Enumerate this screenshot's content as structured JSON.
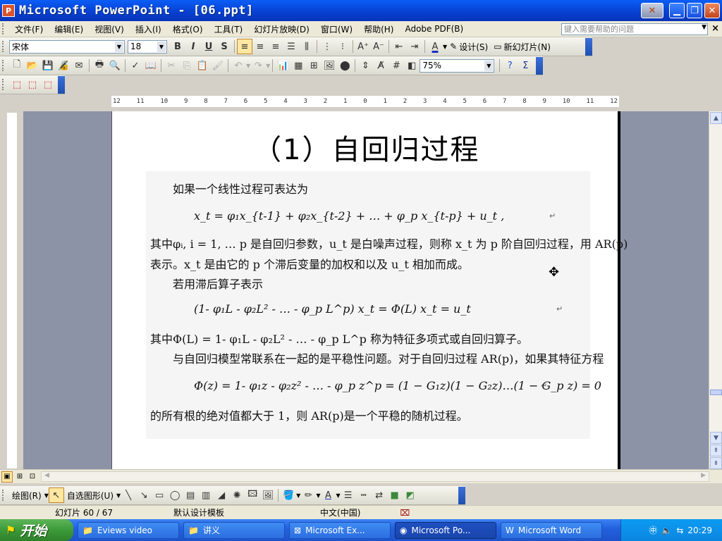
{
  "window": {
    "app_icon": "P",
    "title": "Microsoft PowerPoint - [06.ppt]"
  },
  "menu": {
    "items": [
      "文件(F)",
      "编辑(E)",
      "视图(V)",
      "插入(I)",
      "格式(O)",
      "工具(T)",
      "幻灯片放映(D)",
      "窗口(W)",
      "帮助(H)",
      "Adobe PDF(B)"
    ],
    "help_placeholder": "键入需要帮助的问题"
  },
  "formatting": {
    "font": "宋体",
    "size": "18",
    "design_label": "设计(S)",
    "new_slide_label": "新幻灯片(N)"
  },
  "standard": {
    "zoom": "75%"
  },
  "ruler": {
    "top_ticks": [
      "12",
      "11",
      "10",
      "9",
      "8",
      "7",
      "6",
      "5",
      "4",
      "3",
      "2",
      "1",
      "0",
      "1",
      "2",
      "3",
      "4",
      "5",
      "6",
      "7",
      "8",
      "9",
      "10",
      "11",
      "12"
    ]
  },
  "slide": {
    "title": "（1）自回归过程",
    "lines": [
      "如果一个线性过程可表达为",
      "x_t = φ₁x_{t-1} + φ₂x_{t-2} + … + φ_p x_{t-p} + u_t ,",
      "其中φᵢ, i = 1, … p 是自回归参数，u_t 是白噪声过程，则称 x_t 为 p 阶自回归过程，用 AR(p)",
      "表示。x_t 是由它的 p 个滞后变量的加权和以及 u_t 相加而成。",
      "若用滞后算子表示",
      "(1- φ₁L - φ₂L² - … - φ_p L^p) x_t = Φ(L) x_t = u_t",
      "其中Φ(L) = 1- φ₁L - φ₂L² - … - φ_p L^p 称为特征多项式或自回归算子。",
      "与自回归模型常联系在一起的是平稳性问题。对于自回归过程 AR(p)，如果其特征方程",
      "Φ(z) = 1- φ₁z - φ₂z² - … - φ_p z^p = (1 − G₁z)(1 − G₂z)…(1 − G_p z) = 0",
      "的所有根的绝对值都大于 1，则 AR(p)是一个平稳的随机过程。"
    ]
  },
  "drawing": {
    "draw_label": "绘图(R)",
    "autoshape_label": "自选图形(U)"
  },
  "status": {
    "slide_info": "幻灯片 60 / 67",
    "template": "默认设计模板",
    "language": "中文(中国)"
  },
  "taskbar": {
    "start_label": "开始",
    "tasks": [
      {
        "label": "Eviews video",
        "icon": "folder-icon"
      },
      {
        "label": "讲义",
        "icon": "folder-icon"
      },
      {
        "label": "Microsoft Ex...",
        "icon": "excel-icon"
      },
      {
        "label": "Microsoft Po...",
        "icon": "powerpoint-icon"
      },
      {
        "label": "Microsoft Word",
        "icon": "word-icon"
      }
    ],
    "clock": "20:29"
  }
}
